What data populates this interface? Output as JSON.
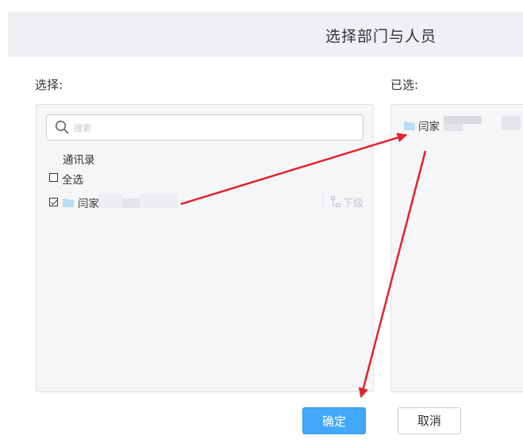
{
  "dialog": {
    "title": "选择部门与人员"
  },
  "left_panel": {
    "label": "选择:",
    "search": {
      "placeholder": "搜索",
      "value": ""
    },
    "contacts_label": "通讯录",
    "select_all_label": "全选",
    "items": [
      {
        "name": "闫家",
        "checked": true,
        "sublevel_label": "下级"
      }
    ]
  },
  "right_panel": {
    "label": "已选:",
    "items": [
      {
        "name": "闫家"
      }
    ]
  },
  "buttons": {
    "confirm": "确定",
    "cancel": "取消"
  },
  "colors": {
    "accent": "#43a8fa",
    "annotation_arrow": "#e5232c",
    "folder": "#b9dcf7",
    "header_bg": "#eef0f4",
    "panel_bg": "#f5f6f8"
  },
  "icons": [
    "search-icon",
    "folder-icon",
    "sublevel-icon"
  ]
}
